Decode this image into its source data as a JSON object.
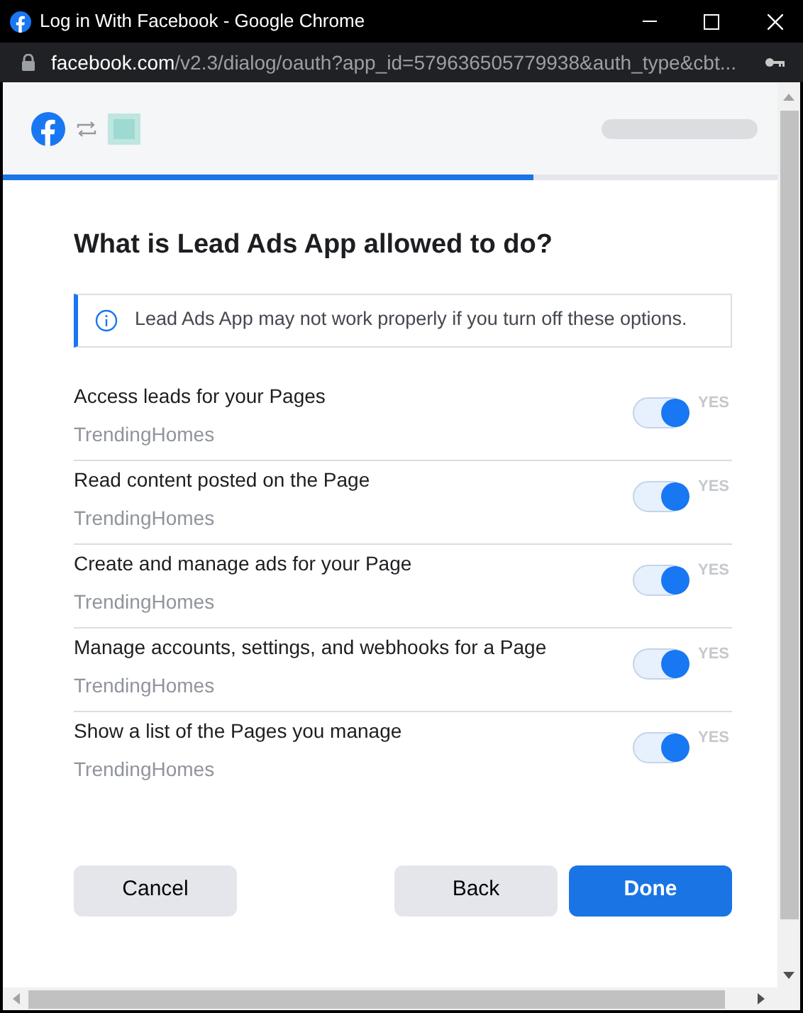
{
  "window": {
    "title": "Log in With Facebook - Google Chrome"
  },
  "address_bar": {
    "domain": "facebook.com",
    "path": "/v2.3/dialog/oauth?app_id=579636505779938&auth_type&cbt..."
  },
  "progress": {
    "level": 0.685
  },
  "heading": "What is Lead Ads App allowed to do?",
  "notice": "Lead Ads App may not work properly if you turn off these options.",
  "permissions": [
    {
      "title": "Access leads for your Pages",
      "page": "TrendingHomes",
      "on": true,
      "state_label": "YES"
    },
    {
      "title": "Read content posted on the Page",
      "page": "TrendingHomes",
      "on": true,
      "state_label": "YES"
    },
    {
      "title": "Create and manage ads for your Page",
      "page": "TrendingHomes",
      "on": true,
      "state_label": "YES"
    },
    {
      "title": "Manage accounts, settings, and webhooks for a Page",
      "page": "TrendingHomes",
      "on": true,
      "state_label": "YES"
    },
    {
      "title": "Show a list of the Pages you manage",
      "page": "TrendingHomes",
      "on": true,
      "state_label": "YES"
    }
  ],
  "buttons": [
    {
      "label": "Cancel",
      "kind": "secondary"
    },
    {
      "label": "Back",
      "kind": "secondary"
    },
    {
      "label": "Done",
      "kind": "primary"
    }
  ]
}
